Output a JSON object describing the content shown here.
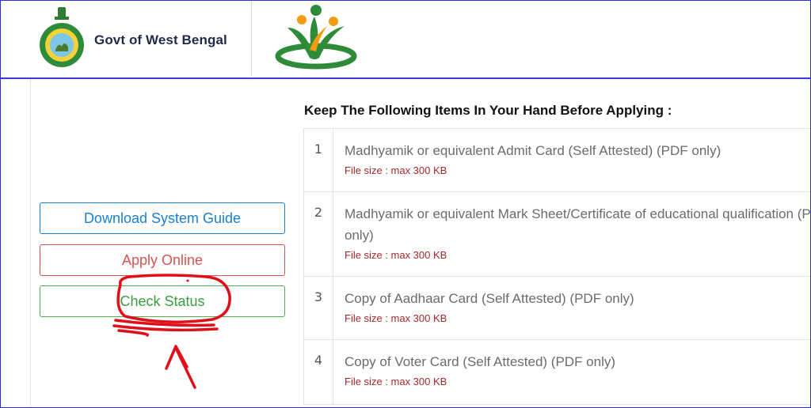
{
  "header": {
    "brand": "Govt of West Bengal",
    "colors": {
      "border": "#3a3ae0",
      "brand_text": "#1f2b4a",
      "logo_green": "#2e8b3a",
      "logo_orange": "#f39c12"
    }
  },
  "sidebar": {
    "buttons": [
      {
        "label": "Download System Guide",
        "color": "#1a7fd0"
      },
      {
        "label": "Apply Online",
        "color": "#d9534f"
      },
      {
        "label": "Check Status",
        "color": "#3a9d3e"
      }
    ]
  },
  "requirements": {
    "heading": "Keep The Following Items In Your Hand Before Applying :",
    "items": [
      {
        "num": "1",
        "title": "Madhyamik or equivalent Admit Card (Self Attested) (PDF only)",
        "size": "File size : max 300 KB"
      },
      {
        "num": "2",
        "title": "Madhyamik or equivalent Mark Sheet/Certificate of educational qualification (PDF only)",
        "size": "File size : max 300 KB"
      },
      {
        "num": "3",
        "title": "Copy of Aadhaar Card (Self Attested) (PDF only)",
        "size": "File size : max 300 KB"
      },
      {
        "num": "4",
        "title": "Copy of Voter Card (Self Attested) (PDF only)",
        "size": "File size : max 300 KB"
      }
    ]
  },
  "annotation": {
    "color": "#e0101a",
    "icon": "hand-drawn-circle-and-arrow"
  }
}
